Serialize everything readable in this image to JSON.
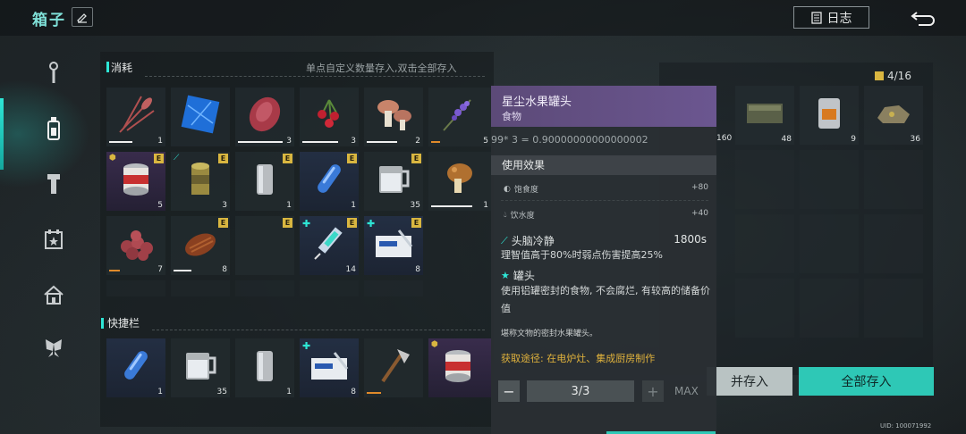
{
  "header": {
    "title": "箱子",
    "log_label": "日志"
  },
  "consumables": {
    "section_title": "消耗",
    "hint": "单点自定义数量存入,双击全部存入",
    "items": [
      {
        "qty": "1",
        "icon": "wheat-icon"
      },
      {
        "qty": "",
        "icon": "blue-crystal-icon"
      },
      {
        "qty": "3",
        "icon": "raw-meat-icon"
      },
      {
        "qty": "3",
        "icon": "berries-icon"
      },
      {
        "qty": "2",
        "icon": "mushroom-icon"
      },
      {
        "qty": "5",
        "icon": "lavender-icon"
      },
      {
        "qty": "5",
        "icon": "canned-fruit-icon"
      },
      {
        "qty": "3",
        "icon": "open-can-icon"
      },
      {
        "qty": "1",
        "icon": "metal-can-icon"
      },
      {
        "qty": "1",
        "icon": "blue-capsule-icon"
      },
      {
        "qty": "35",
        "icon": "water-mug-icon"
      },
      {
        "qty": "1",
        "icon": "cooked-mushroom-icon"
      },
      {
        "qty": "7",
        "icon": "berry-pile-icon"
      },
      {
        "qty": "8",
        "icon": "roast-meat-icon"
      },
      {
        "qty": "",
        "icon": "empty-slot"
      },
      {
        "qty": "14",
        "icon": "syringe-icon"
      },
      {
        "qty": "8",
        "icon": "medkit-icon"
      }
    ]
  },
  "quickbar": {
    "section_title": "快捷栏",
    "items": [
      {
        "qty": "1",
        "icon": "blue-capsule-icon"
      },
      {
        "qty": "35",
        "icon": "water-mug-icon"
      },
      {
        "qty": "1",
        "icon": "metal-can-icon"
      },
      {
        "qty": "8",
        "icon": "medkit-icon"
      },
      {
        "qty": "",
        "icon": "axe-icon"
      },
      {
        "qty": "",
        "icon": "canned-fruit-icon"
      }
    ]
  },
  "storage": {
    "count": "4/16",
    "qty": [
      "160",
      "48",
      "9",
      "36"
    ],
    "store_button": "并存入",
    "store_all_button": "全部存入",
    "uid": "UID: 100071992"
  },
  "tooltip": {
    "name": "星尘水果罐头",
    "type": "食物",
    "formula": "99* 3 = 0.90000000000000002",
    "effect_header": "使用效果",
    "stats": [
      {
        "label": "饱食度",
        "value": "+80"
      },
      {
        "label": "饮水度",
        "value": "+40"
      }
    ],
    "buff1": {
      "name": "头脑冷静",
      "duration": "1800s",
      "desc": "理智值高于80%时弱点伤害提高25%"
    },
    "buff2": {
      "name": "罐头",
      "desc": "使用铝罐密封的食物, 不会腐烂, 有较高的储备价值"
    },
    "flavor": "堪称文物的密封水果罐头。",
    "source": "获取途径: 在电炉灶、集成厨房制作",
    "quantity": "3/3",
    "max_label": "MAX",
    "minus": "−",
    "plus": "+"
  },
  "colors": {
    "accent": "#2ee6d6",
    "legendary": "#d9b640",
    "tooltip_header": "#6b5690"
  }
}
